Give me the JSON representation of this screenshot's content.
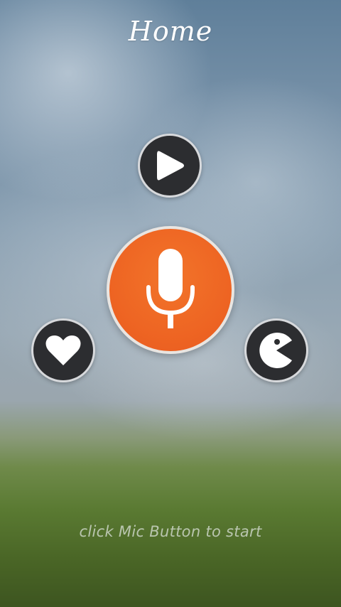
{
  "header": {
    "title": "Home"
  },
  "buttons": {
    "play": {
      "icon": "play-icon"
    },
    "mic": {
      "icon": "microphone-icon"
    },
    "heart": {
      "icon": "heart-icon"
    },
    "pacman": {
      "icon": "pacman-icon"
    }
  },
  "footer": {
    "hint": "click Mic Button to start"
  },
  "colors": {
    "mic_button": "#ee6523",
    "round_button": "#2c2d30",
    "button_border": "#d7d9dc",
    "icon": "#ffffff"
  }
}
